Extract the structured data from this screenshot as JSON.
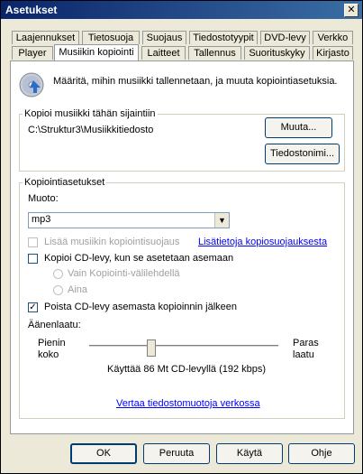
{
  "window": {
    "title": "Asetukset",
    "close_label": "✕"
  },
  "tabs_row1": [
    "Laajennukset",
    "Tietosuoja",
    "Suojaus",
    "Tiedostotyypit",
    "DVD-levy",
    "Verkko"
  ],
  "tabs_row2": [
    "Player",
    "Musiikin kopiointi",
    "Laitteet",
    "Tallennus",
    "Suorituskyky",
    "Kirjasto"
  ],
  "active_tab": "Musiikin kopiointi",
  "description": "Määritä, mihin musiikki tallennetaan, ja muuta kopiointiasetuksia.",
  "location_group": {
    "label": "Kopioi musiikki tähän sijaintiin",
    "path": "C:\\Struktur3\\Musiikkitiedosto",
    "change_button": "Muuta...",
    "filename_button": "Tiedostonimi..."
  },
  "settings_group": {
    "label": "Kopiointiasetukset",
    "format_label": "Muoto:",
    "format_value": "mp3",
    "protect_label": "Lisää musiikin kopiointisuojaus",
    "protect_checked": false,
    "protect_link": "Lisätietoja kopiosuojauksesta",
    "copy_cd_label": "Kopioi CD-levy, kun se asetetaan asemaan",
    "copy_cd_checked": false,
    "radio_tab_label": "Vain Kopiointi-välilehdellä",
    "radio_always_label": "Aina",
    "eject_label": "Poista CD-levy asemasta kopioinnin jälkeen",
    "eject_checked": true,
    "quality_label": "Äänenlaatu:",
    "smallest_label_1": "Pienin",
    "smallest_label_2": "koko",
    "best_label_1": "Paras",
    "best_label_2": "laatu",
    "quality_level": 0.32,
    "usage_text": "Käyttää 86 Mt CD-levyllä (192 kbps)",
    "compare_link": "Vertaa tiedostomuotoja verkossa"
  },
  "buttons": {
    "ok": "OK",
    "cancel": "Peruuta",
    "apply": "Käytä",
    "help": "Ohje"
  }
}
